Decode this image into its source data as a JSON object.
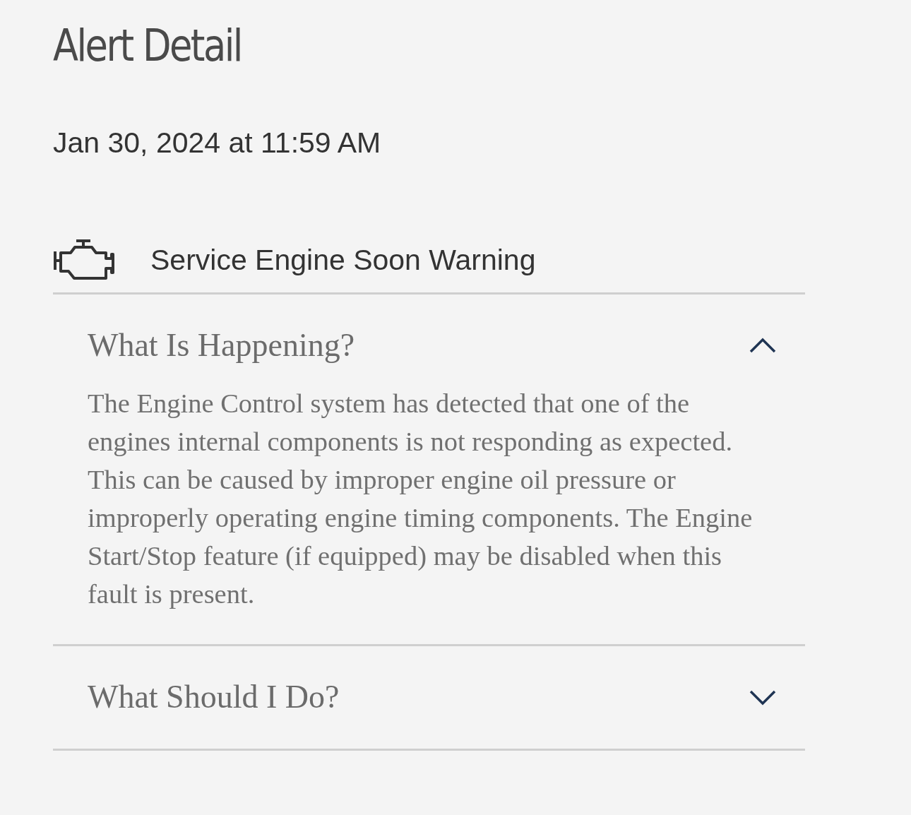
{
  "page_title": "Alert Detail",
  "timestamp": "Jan 30, 2024 at 11:59 AM",
  "alert": {
    "title": "Service Engine Soon Warning"
  },
  "sections": [
    {
      "title": "What Is Happening?",
      "expanded": true,
      "body": "The Engine Control system has detected that one of the engines internal components is not responding as expected. This can be caused by improper engine oil pressure or improperly operating engine timing components. The Engine Start/Stop feature (if equipped) may be disabled when this fault is present."
    },
    {
      "title": "What Should I Do?",
      "expanded": false
    }
  ]
}
